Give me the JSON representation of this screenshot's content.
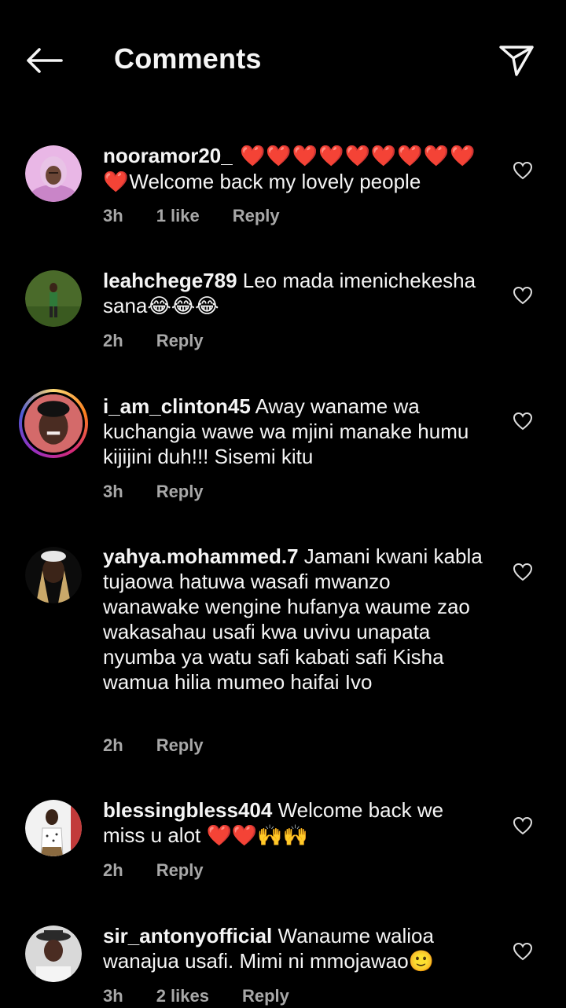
{
  "header": {
    "title": "Comments"
  },
  "comments": [
    {
      "username": "nooramor20_",
      "text_prefix": " ❤️❤️❤️❤️❤️❤️❤️❤️❤️❤️",
      "text": "Welcome back my lovely people",
      "time": "3h",
      "likes": "1 like",
      "reply": "Reply"
    },
    {
      "username": "leahchege789",
      "text": " Leo mada imenichekesha sana😂😂😂",
      "time": "2h",
      "reply": "Reply"
    },
    {
      "username": "i_am_clinton45",
      "text": " Away waname wa kuchangia wawe wa mjini manake humu kijijini duh!!! Sisemi kitu",
      "time": "3h",
      "reply": "Reply"
    },
    {
      "username": "yahya.mohammed.7",
      "text": " Jamani kwani kabla tujaowa hatuwa wasafi mwanzo wanawake wengine hufanya waume zao wakasahau usafi kwa uvivu unapata nyumba ya watu safi kabati safi Kisha wamua hilia mumeo haifai Ivo",
      "time": "2h",
      "reply": "Reply"
    },
    {
      "username": "blessingbless404",
      "text": " Welcome back we miss u alot ❤️❤️🙌🙌",
      "time": "2h",
      "reply": "Reply"
    },
    {
      "username": "sir_antonyofficial",
      "text": " Wanaume walioa wanajua usafi. Mimi ni mmojawao🙂",
      "time": "3h",
      "likes": "2 likes",
      "reply": "Reply"
    }
  ],
  "colors": {
    "background": "#000000",
    "text": "#f5f5f5",
    "meta": "#a8a8a8",
    "heart_emoji": "#ff2d2d"
  },
  "icons": {
    "back": "back-arrow-icon",
    "share": "paper-plane-icon",
    "like": "heart-outline-icon"
  }
}
